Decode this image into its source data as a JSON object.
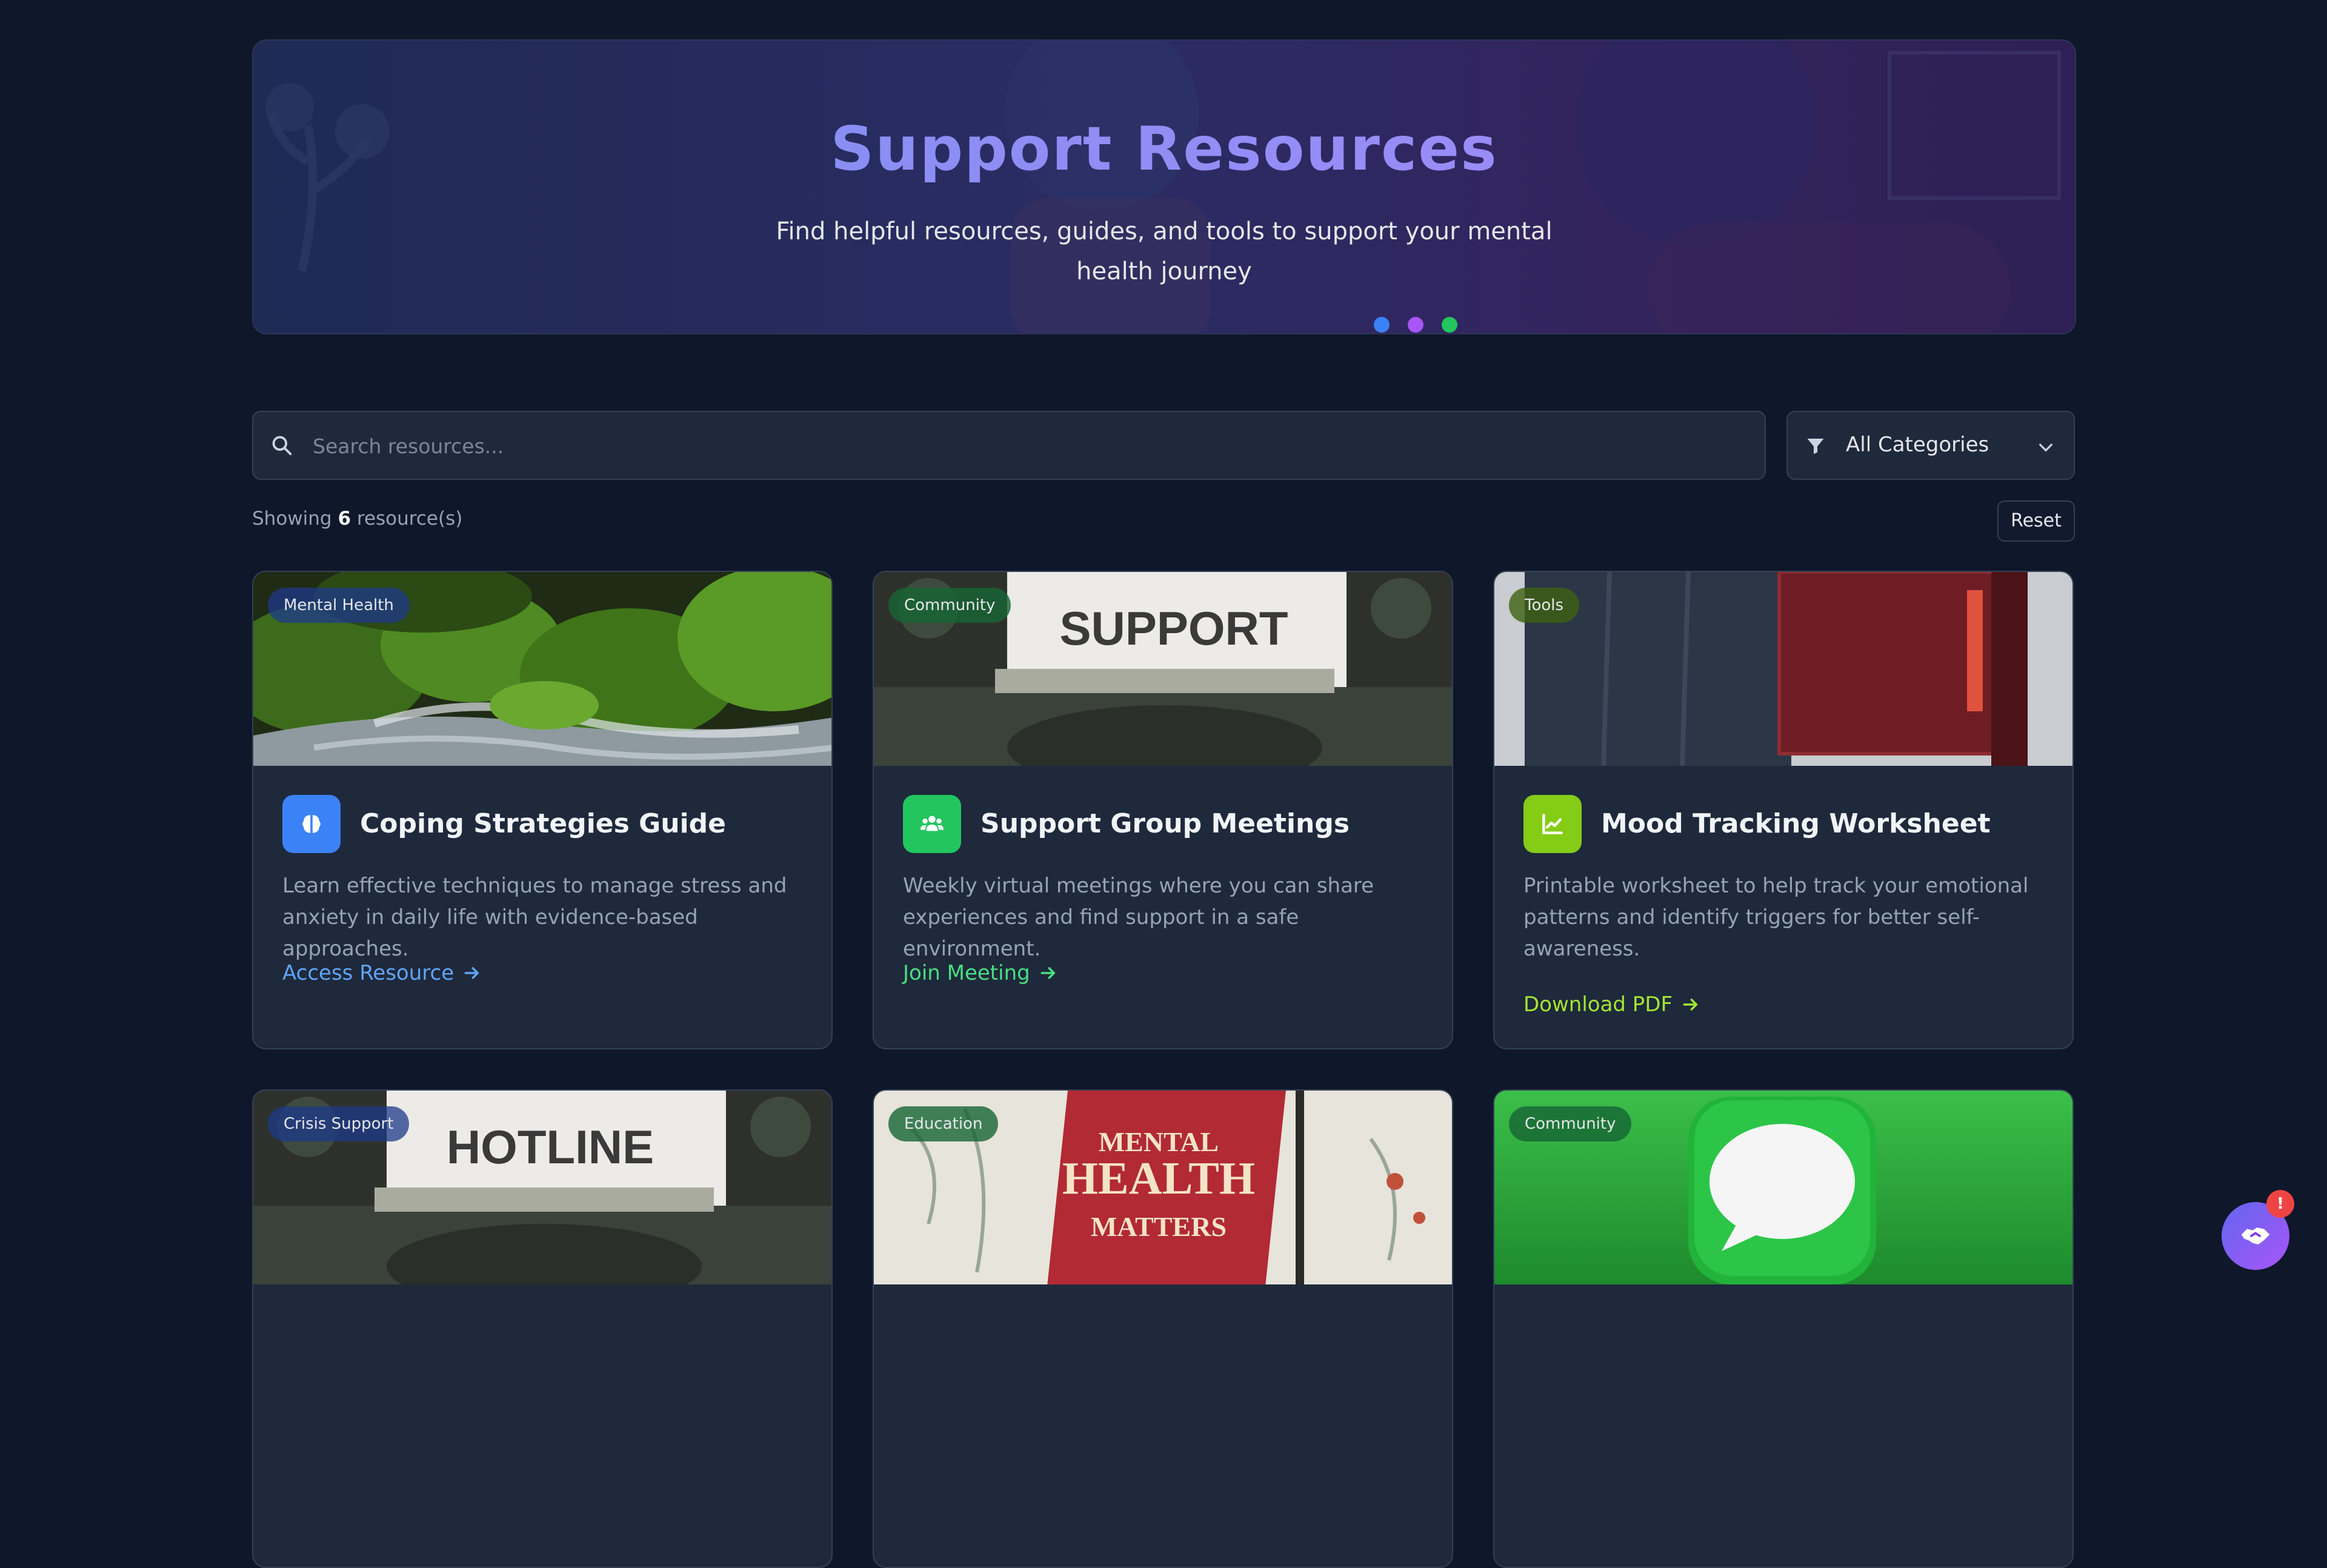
{
  "hero": {
    "title": "Support Resources",
    "subtitle": "Find helpful resources, guides, and tools to support your mental health journey",
    "dots": [
      "#3b82f6",
      "#a855f7",
      "#22c55e"
    ]
  },
  "search": {
    "placeholder": "Search resources...",
    "value": "",
    "icon": "search-icon"
  },
  "category_filter": {
    "selected": "All Categories",
    "icon": "filter-icon"
  },
  "results": {
    "prefix": "Showing",
    "count": "6",
    "suffix": "resource(s)"
  },
  "reset_label": "Reset",
  "cards": [
    {
      "category": "Mental Health",
      "title": "Coping Strategies Guide",
      "description": "Learn effective techniques to manage stress and anxiety in daily life with evidence-based approaches.",
      "link": "Access Resource",
      "icon": "brain-icon",
      "icon_color": "#3b82f6",
      "link_color": "#60a5fa",
      "image": "mossy-stream"
    },
    {
      "category": "Community",
      "title": "Support Group Meetings",
      "description": "Weekly virtual meetings where you can share experiences and find support in a safe environment.",
      "link": "Join Meeting",
      "icon": "users-icon",
      "icon_color": "#22c55e",
      "link_color": "#4ade80",
      "image": "typewriter",
      "image_text": "SUPPORT"
    },
    {
      "category": "Tools",
      "title": "Mood Tracking Worksheet",
      "description": "Printable worksheet to help track your emotional patterns and identify triggers for better self-awareness.",
      "link": "Download PDF",
      "icon": "chart-line-icon",
      "icon_color": "#84cc16",
      "link_color": "#a3e635",
      "image": "notebooks"
    },
    {
      "category": "Crisis Support",
      "image": "typewriter",
      "image_text": "HOTLINE"
    },
    {
      "category": "Education",
      "image": "book",
      "image_text_lines": [
        "MENTAL",
        "HEALTH",
        "MATTERS"
      ]
    },
    {
      "category": "Community",
      "image": "chat-bubble"
    }
  ],
  "fab": {
    "icon": "handshake-icon",
    "badge": "!"
  }
}
